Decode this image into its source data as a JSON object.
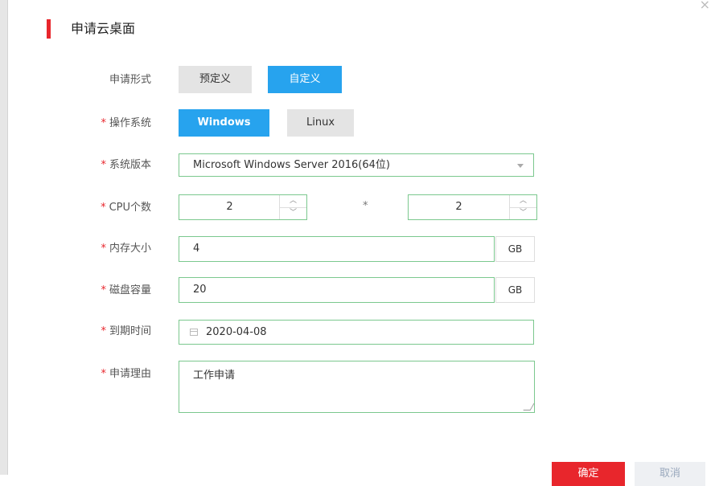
{
  "dialog": {
    "title": "申请云桌面",
    "close_glyph": "×"
  },
  "form": {
    "apply_type": {
      "label": "申请形式",
      "options": [
        "预定义",
        "自定义"
      ],
      "selected": "自定义"
    },
    "os": {
      "label": "操作系统",
      "required_mark": "*",
      "options": [
        "Windows",
        "Linux"
      ],
      "selected": "Windows"
    },
    "os_version": {
      "label": "系统版本",
      "required_mark": "*",
      "value": "Microsoft Windows Server 2016(64位)"
    },
    "cpu": {
      "label": "CPU个数",
      "required_mark": "*",
      "value1": "2",
      "multiplier": "*",
      "value2": "2",
      "up_glyph": "︿",
      "down_glyph": "﹀"
    },
    "memory": {
      "label": "内存大小",
      "required_mark": "*",
      "value": "4",
      "unit": "GB"
    },
    "disk": {
      "label": "磁盘容量",
      "required_mark": "*",
      "value": "20",
      "unit": "GB"
    },
    "expire": {
      "label": "到期时间",
      "required_mark": "*",
      "value": "2020-04-08"
    },
    "reason": {
      "label": "申请理由",
      "required_mark": "*",
      "value": "工作申请"
    }
  },
  "footer": {
    "ok_label": "确定",
    "cancel_label": "取消"
  },
  "colors": {
    "accent_red": "#e8262c",
    "active_blue": "#27a3ee",
    "field_border": "#7bc88e"
  }
}
